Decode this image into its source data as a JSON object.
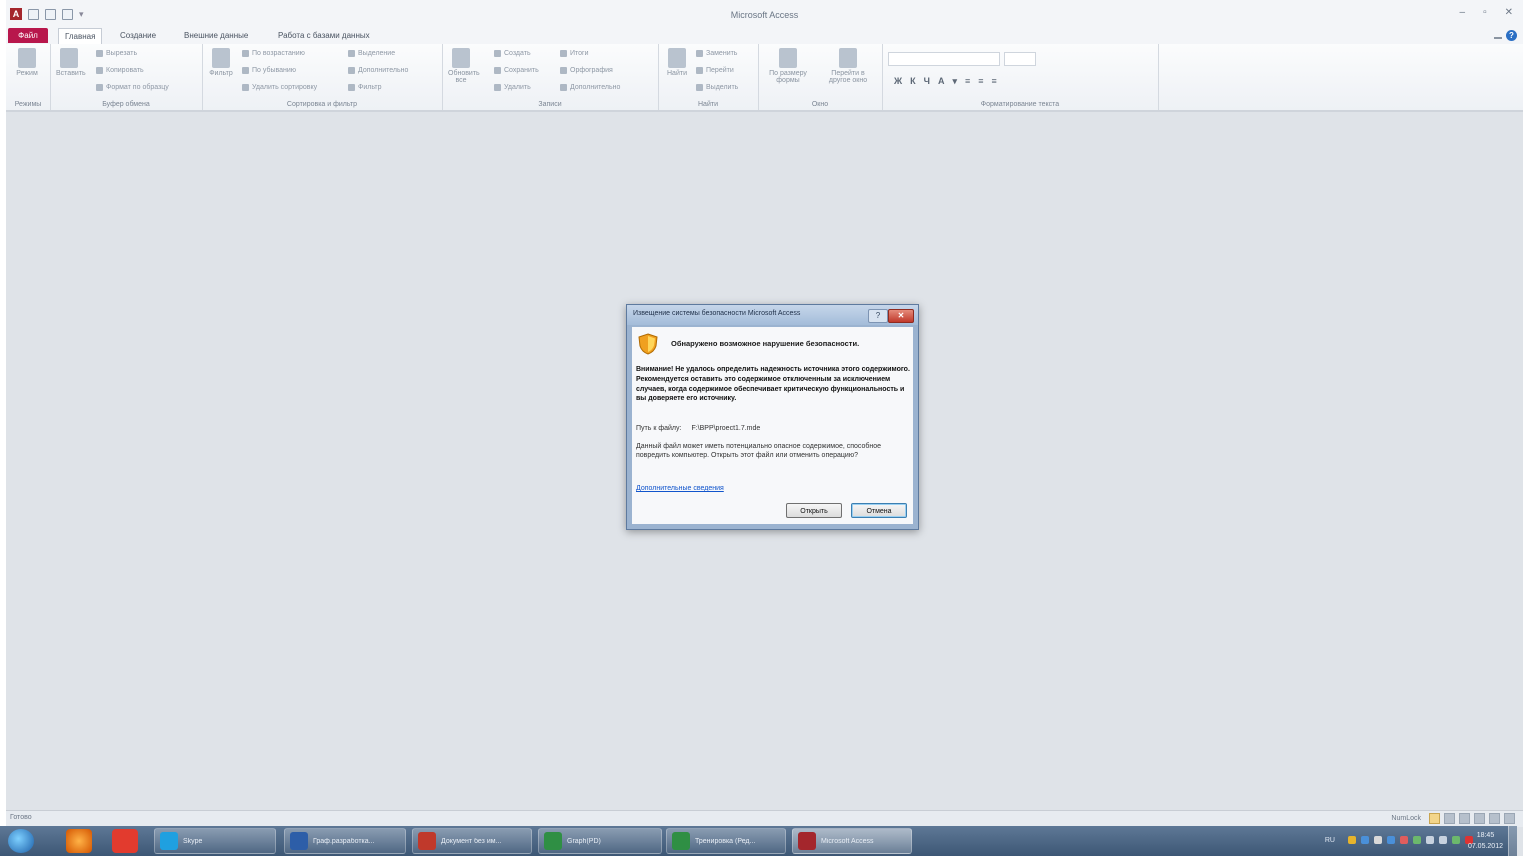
{
  "window": {
    "title": "Microsoft Access",
    "quick_access": [
      "save",
      "undo",
      "redo",
      "customize"
    ]
  },
  "ribbon": {
    "file_tab": "Файл",
    "tabs": [
      {
        "label": "Главная",
        "active": true
      },
      {
        "label": "Создание",
        "active": false
      },
      {
        "label": "Внешние данные",
        "active": false
      },
      {
        "label": "Работа с базами данных",
        "active": false
      }
    ],
    "groups": {
      "views": {
        "label": "Режимы",
        "view": "Режим"
      },
      "clipboard": {
        "label": "Буфер обмена",
        "paste": "Вставить",
        "cut": "Вырезать",
        "copy": "Копировать",
        "format_painter": "Формат по образцу"
      },
      "sort_filter": {
        "label": "Сортировка и фильтр",
        "filter": "Фильтр",
        "ascending": "По возрастанию",
        "descending": "По убыванию",
        "remove_sort": "Удалить сортировку",
        "selection": "Выделение",
        "advanced": "Дополнительно",
        "toggle_filter": "Фильтр"
      },
      "records": {
        "label": "Записи",
        "refresh": "Обновить все",
        "new": "Создать",
        "save": "Сохранить",
        "delete": "Удалить",
        "totals": "Итоги",
        "spelling": "Орфография",
        "more": "Дополнительно"
      },
      "find": {
        "label": "Найти",
        "find": "Найти",
        "replace": "Заменить",
        "goto": "Перейти",
        "select": "Выделить"
      },
      "window": {
        "label": "Окно",
        "fit": "По размеру формы",
        "switch": "Перейти в другое окно"
      },
      "text_format": {
        "label": "Форматирование текста"
      }
    }
  },
  "status": {
    "left": "Готово",
    "right_label": "NumLock"
  },
  "dialog": {
    "title": "Извещение системы безопасности Microsoft Access",
    "help_button": "?",
    "close_button": "✕",
    "heading": "Обнаружено возможное нарушение безопасности.",
    "warning": "Внимание! Не удалось определить надежность источника этого содержимого. Рекомендуется оставить это содержимое отключенным за исключением случаев, когда содержимое обеспечивает критическую функциональность и вы доверяете его источнику.",
    "path_label": "Путь к файлу:",
    "path_value": "F:\\BPP\\proect1.7.mde",
    "note": "Данный файл может иметь потенциально опасное содержимое, способное повредить компьютер. Открыть этот файл или отменить операцию?",
    "more_link": "Дополнительные сведения",
    "open_button": "Открыть",
    "cancel_button": "Отмена"
  },
  "taskbar": {
    "items": [
      {
        "label": "Skype",
        "color": "#1fa0e0"
      },
      {
        "label": "Граф.разработка...",
        "color": "#2d5ea8"
      },
      {
        "label": "Документ без им...",
        "color": "#c0392b"
      },
      {
        "label": "Graph(PD)",
        "color": "#2f8f44"
      },
      {
        "label": "Тренировка (Ред...",
        "color": "#2f8f44"
      },
      {
        "label": "Microsoft Access",
        "color": "#a4262c"
      }
    ],
    "lang": "RU",
    "time": "18:45",
    "date": "07.05.2012"
  }
}
